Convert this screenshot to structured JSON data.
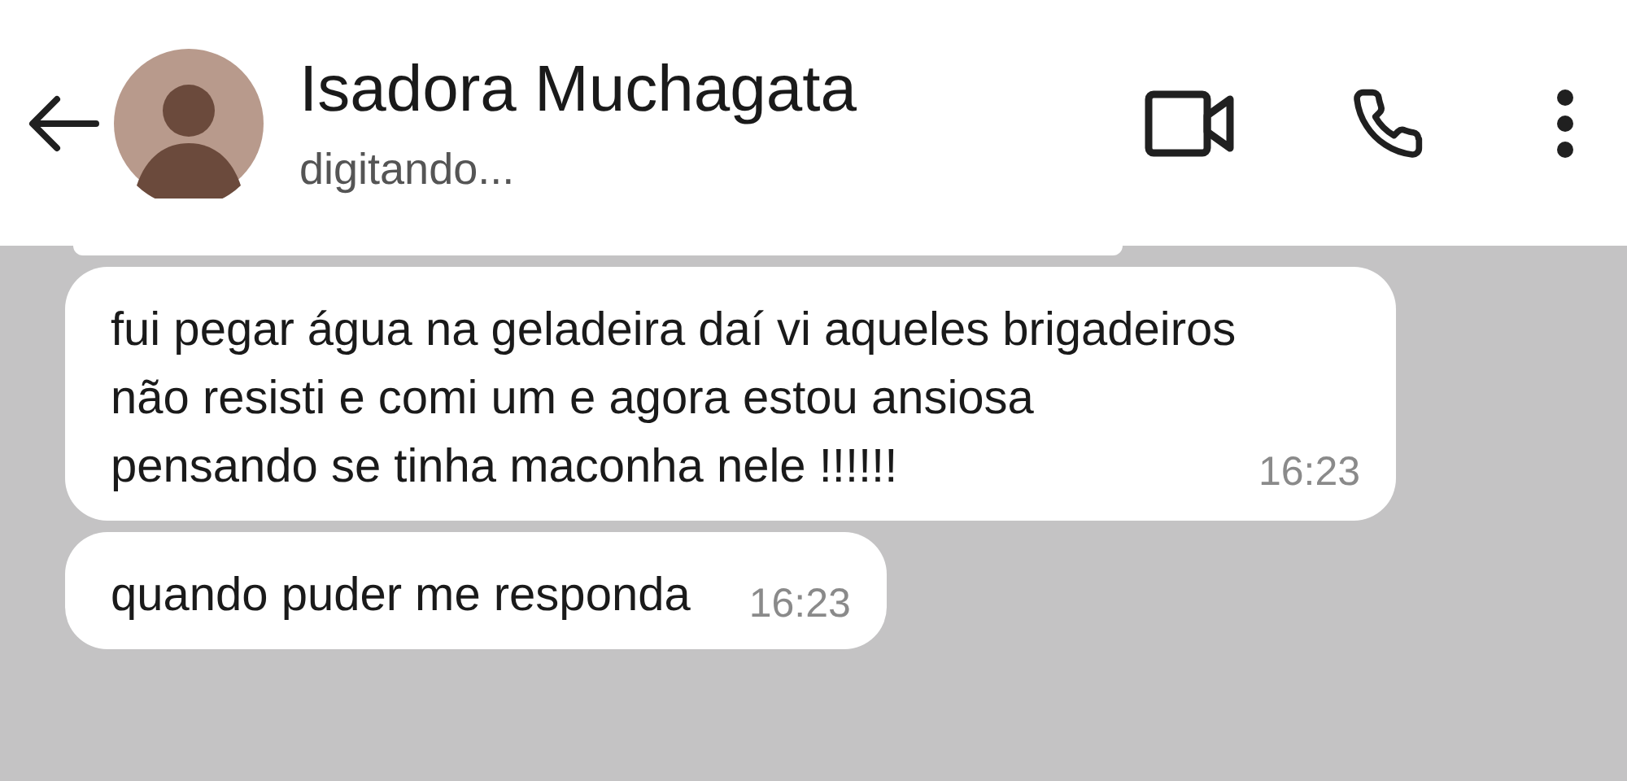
{
  "header": {
    "name": "Isadora Muchagata",
    "status": "digitando..."
  },
  "messages": [
    {
      "text": "fui pegar água na geladeira daí vi aqueles brigadeiros não resisti e comi um e agora estou ansiosa pensando se tinha maconha nele !!!!!!",
      "time": "16:23"
    },
    {
      "text": "quando puder me responda",
      "time": "16:23"
    }
  ]
}
